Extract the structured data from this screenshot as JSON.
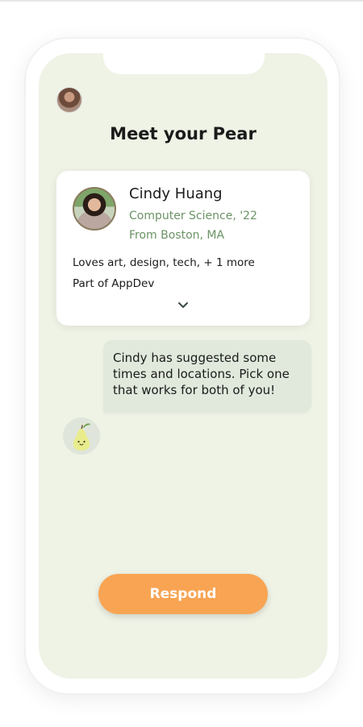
{
  "header": {
    "title": "Meet your Pear"
  },
  "profile": {
    "name": "Cindy Huang",
    "major": "Computer Science, '22",
    "hometown": "From Boston, MA",
    "interests": "Loves art, design, tech, + 1 more",
    "club": "Part of AppDev"
  },
  "message": {
    "text": "Cindy has suggested some times and locations. Pick one that works for both of you!"
  },
  "actions": {
    "respond_label": "Respond"
  },
  "colors": {
    "background": "#eff3e6",
    "accent_green": "#6b9366",
    "button_orange": "#f8a453",
    "bubble": "#e0e9dc"
  },
  "icons": {
    "expand": "chevron-down-icon",
    "pear": "pear-mascot-icon"
  }
}
